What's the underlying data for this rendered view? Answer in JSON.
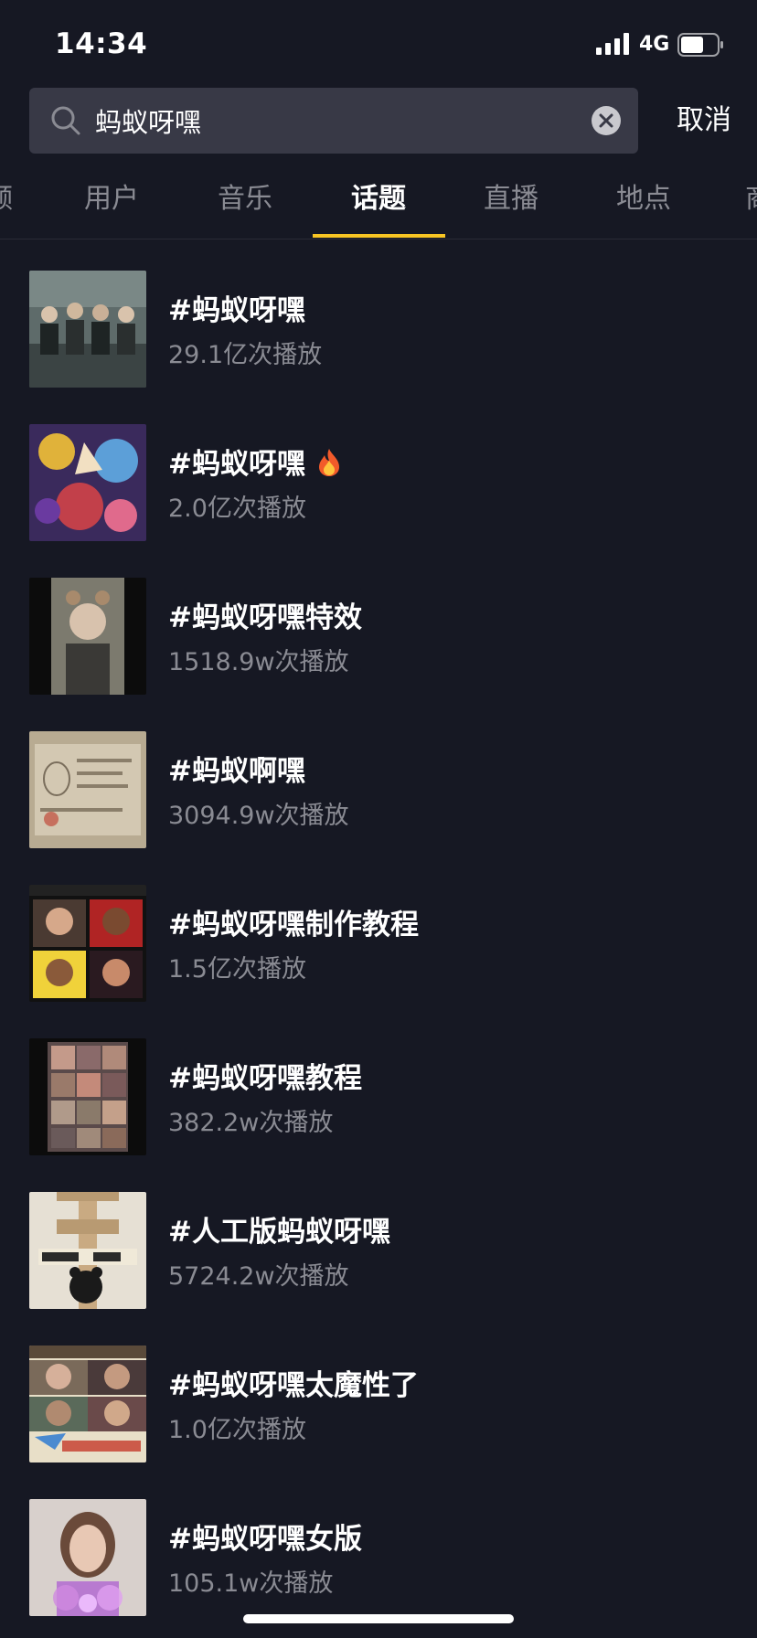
{
  "status_bar": {
    "time": "14:34",
    "network": "4G",
    "signal_icon": "cellular-signal-icon",
    "battery_icon": "battery-icon"
  },
  "search": {
    "icon": "search-icon",
    "value": "蚂蚁呀嘿",
    "clear_icon": "clear-icon",
    "cancel_label": "取消"
  },
  "tabs": [
    {
      "label": "视频",
      "active": false
    },
    {
      "label": "用户",
      "active": false
    },
    {
      "label": "音乐",
      "active": false
    },
    {
      "label": "话题",
      "active": true
    },
    {
      "label": "直播",
      "active": false
    },
    {
      "label": "地点",
      "active": false
    },
    {
      "label": "商品",
      "active": false
    }
  ],
  "results": [
    {
      "title": "#蚂蚁呀嘿",
      "plays": "29.1亿次播放",
      "hot": false
    },
    {
      "title": "#蚂蚁呀嘿",
      "plays": "2.0亿次播放",
      "hot": true
    },
    {
      "title": "#蚂蚁呀嘿特效",
      "plays": "1518.9w次播放",
      "hot": false
    },
    {
      "title": "#蚂蚁啊嘿",
      "plays": "3094.9w次播放",
      "hot": false
    },
    {
      "title": "#蚂蚁呀嘿制作教程",
      "plays": "1.5亿次播放",
      "hot": false
    },
    {
      "title": "#蚂蚁呀嘿教程",
      "plays": "382.2w次播放",
      "hot": false
    },
    {
      "title": "#人工版蚂蚁呀嘿",
      "plays": "5724.2w次播放",
      "hot": false
    },
    {
      "title": "#蚂蚁呀嘿太魔性了",
      "plays": "1.0亿次播放",
      "hot": false
    },
    {
      "title": "#蚂蚁呀嘿女版",
      "plays": "105.1w次播放",
      "hot": false
    }
  ],
  "hot_icon": "fire-icon",
  "colors": {
    "background": "#161823",
    "search_bg": "#383946",
    "accent": "#f8c523",
    "secondary_text": "#8a8b93"
  }
}
